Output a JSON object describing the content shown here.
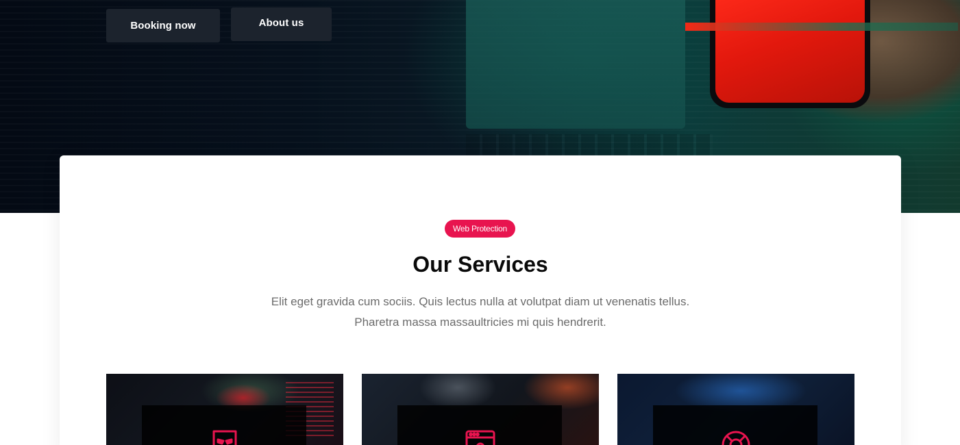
{
  "hero": {
    "buttons": {
      "booking_label": "Booking now",
      "about_label": "About us"
    }
  },
  "services": {
    "badge": "Web Protection",
    "title": "Our Services",
    "description_line1": "Elit eget gravida cum sociis. Quis lectus nulla at volutpat diam ut venenatis tellus.",
    "description_line2": "Pharetra massa massaultricies mi quis hendrerit.",
    "cards": [
      {
        "icon": "mask-icon"
      },
      {
        "icon": "browser-window-icon"
      },
      {
        "icon": "lifebuoy-icon"
      }
    ]
  },
  "colors": {
    "accent": "#e8144f",
    "button_bg": "#1c232d",
    "title": "#0a0a0a",
    "body_text": "#6b6b6b"
  }
}
